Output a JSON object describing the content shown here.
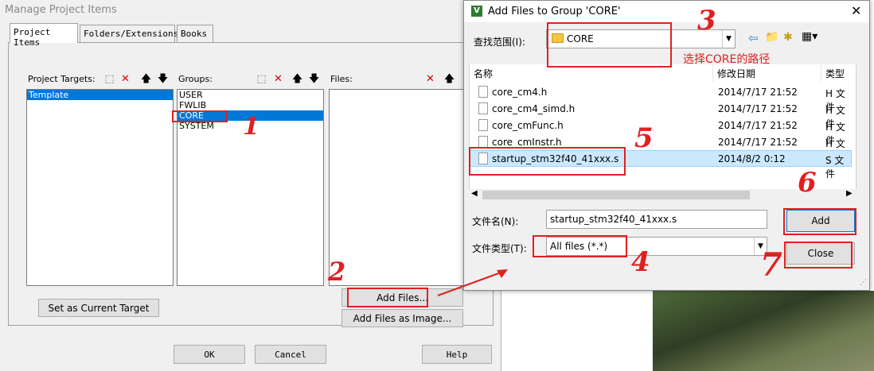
{
  "manage_dialog": {
    "title": "Manage Project Items",
    "tabs": [
      "Project Items",
      "Folders/Extensions",
      "Books"
    ],
    "targets": {
      "header": "Project Targets:",
      "items": [
        "Template"
      ]
    },
    "groups": {
      "header": "Groups:",
      "items": [
        "USER",
        "FWLIB",
        "CORE",
        "SYSTEM"
      ]
    },
    "files": {
      "header": "Files:",
      "items": []
    },
    "buttons": {
      "set_current": "Set as Current Target",
      "add_files": "Add Files...",
      "add_files_image": "Add Files as Image...",
      "ok": "OK",
      "cancel": "Cancel",
      "help": "Help"
    }
  },
  "add_dialog": {
    "title": "Add Files to Group 'CORE'",
    "look_in_label": "查找范围(I):",
    "look_in_value": "CORE",
    "columns": [
      "名称",
      "修改日期",
      "类型"
    ],
    "files": [
      {
        "name": "core_cm4.h",
        "date": "2014/7/17 21:52",
        "type": "H 文件"
      },
      {
        "name": "core_cm4_simd.h",
        "date": "2014/7/17 21:52",
        "type": "H 文件"
      },
      {
        "name": "core_cmFunc.h",
        "date": "2014/7/17 21:52",
        "type": "H 文件"
      },
      {
        "name": "core_cmInstr.h",
        "date": "2014/7/17 21:52",
        "type": "H 文件"
      },
      {
        "name": "startup_stm32f40_41xxx.s",
        "date": "2014/8/2 0:12",
        "type": "S 文件"
      }
    ],
    "filename_label": "文件名(N):",
    "filename_value": "startup_stm32f40_41xxx.s",
    "filetype_label": "文件类型(T):",
    "filetype_value": "All files (*.*)",
    "add_button": "Add",
    "close_button": "Close"
  },
  "annotations": {
    "step1": "1",
    "step2": "2",
    "step3": "3",
    "step4": "4",
    "step5": "5",
    "step6": "6",
    "step7": "7",
    "path_note": "选择CORE的路径",
    "color": "#e02020"
  }
}
